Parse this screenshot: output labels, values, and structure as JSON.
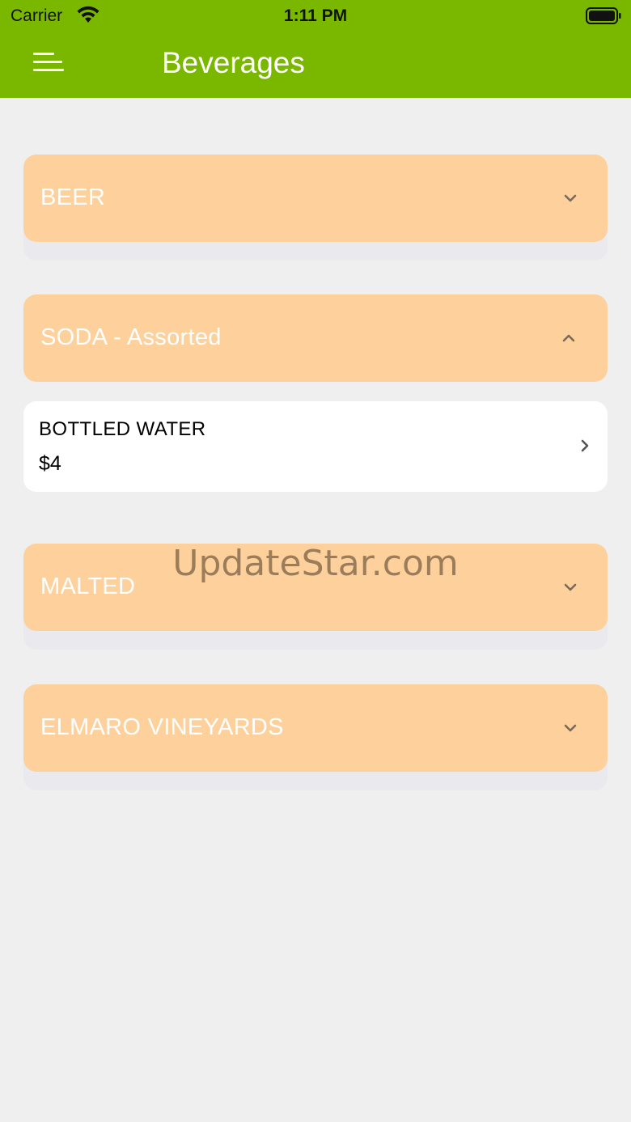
{
  "status_bar": {
    "carrier": "Carrier",
    "time": "1:11 PM"
  },
  "header": {
    "title": "Beverages"
  },
  "sections": [
    {
      "label": "BEER",
      "state": "collapsed"
    },
    {
      "label": "SODA - Assorted",
      "state": "expanded"
    },
    {
      "label": "MALTED",
      "state": "collapsed"
    },
    {
      "label": "ELMARO VINEYARDS",
      "state": "collapsed"
    }
  ],
  "items": [
    {
      "name": "BOTTLED WATER",
      "price": "$4"
    }
  ],
  "watermark": "UpdateStar.com",
  "icons": {
    "menu": "menu-icon",
    "wifi": "wifi-icon",
    "battery": "battery-icon",
    "expand": "chevron-down-icon",
    "collapse": "chevron-up-icon",
    "open": "chevron-right-icon"
  },
  "colors": {
    "header_bg": "#7ab800",
    "section_bg": "#fed19c",
    "page_bg": "#efeff0",
    "card_bg": "#ffffff"
  }
}
